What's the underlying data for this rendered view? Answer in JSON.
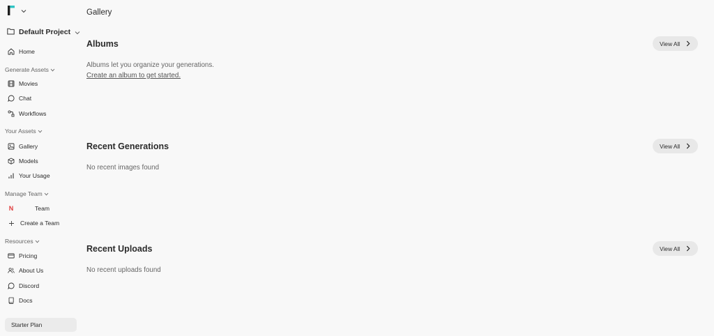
{
  "sidebar": {
    "project": {
      "label": "Default Project"
    },
    "home": {
      "label": "Home"
    },
    "sections": {
      "generate_assets": "Generate Assets",
      "your_assets": "Your Assets",
      "manage_team": "Manage Team",
      "resources": "Resources"
    },
    "generate_items": [
      {
        "label": "Movies",
        "icon": "film-icon"
      },
      {
        "label": "Chat",
        "icon": "chat-bubble-icon"
      },
      {
        "label": "Workflows",
        "icon": "workflow-icon"
      }
    ],
    "asset_items": [
      {
        "label": "Gallery",
        "icon": "image-icon"
      },
      {
        "label": "Models",
        "icon": "cube-icon"
      },
      {
        "label": "Your Usage",
        "icon": "bar-chart-icon"
      }
    ],
    "team_items": [
      {
        "label": "Team",
        "badge": "N"
      },
      {
        "label": "Create a Team",
        "icon": "plus-icon"
      }
    ],
    "resource_items": [
      {
        "label": "Pricing",
        "icon": "credit-card-icon"
      },
      {
        "label": "About Us",
        "icon": "users-icon"
      },
      {
        "label": "Discord",
        "icon": "discord-icon"
      },
      {
        "label": "Docs",
        "icon": "book-icon"
      }
    ],
    "plan": {
      "label": "Starter Plan"
    }
  },
  "main": {
    "page_title": "Gallery",
    "albums": {
      "title": "Albums",
      "view_all": "View All",
      "empty_prefix": "Albums let you organize your generations.",
      "empty_link": "Create an album to get started."
    },
    "recent_generations": {
      "title": "Recent Generations",
      "view_all": "View All",
      "empty": "No recent images found"
    },
    "recent_uploads": {
      "title": "Recent Uploads",
      "view_all": "View All",
      "empty": "No recent uploads found"
    }
  },
  "colors": {
    "background": "#f8f8f8",
    "logo_teal": "#2ec4c4",
    "logo_dark": "#1f1f1f",
    "team_badge": "#e03b3b",
    "button_bg": "#e8e8e8"
  }
}
